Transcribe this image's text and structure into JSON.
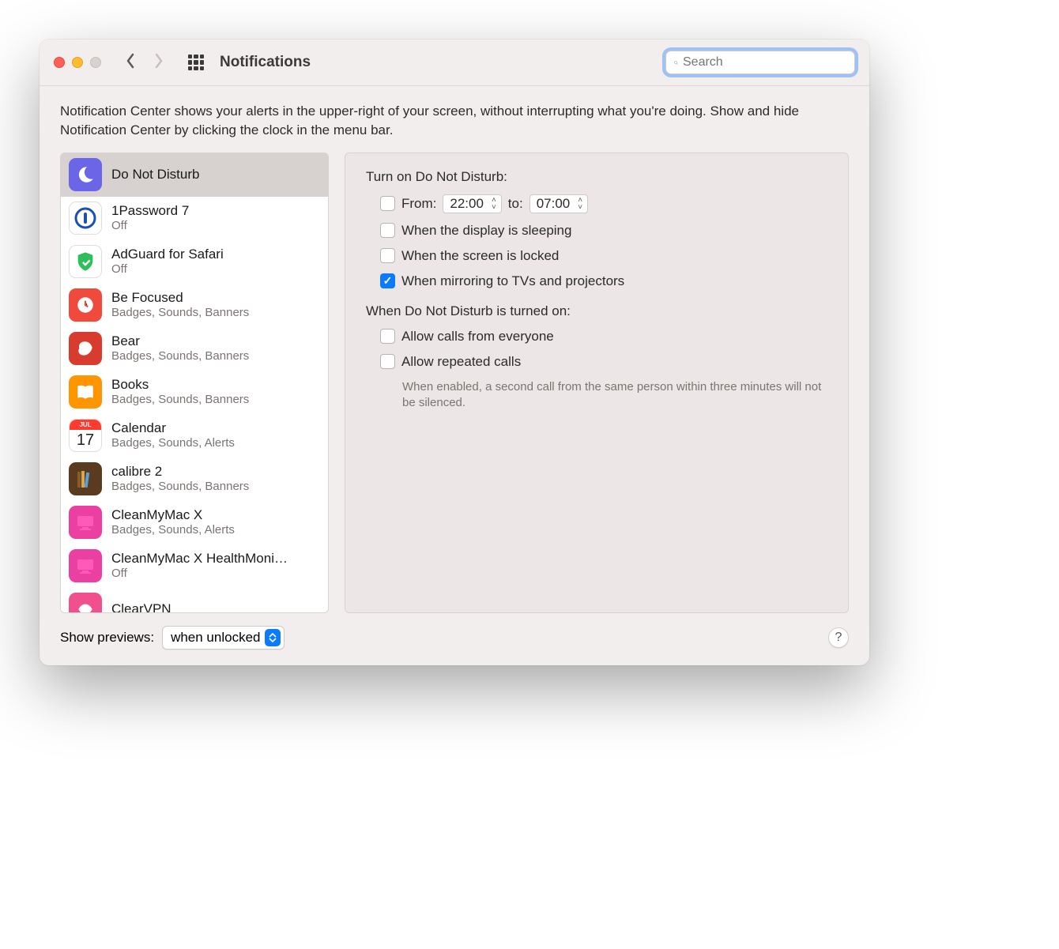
{
  "window": {
    "title": "Notifications",
    "search_placeholder": "Search"
  },
  "description": "Notification Center shows your alerts in the upper-right of your screen, without interrupting what you're doing. Show and hide Notification Center by clicking the clock in the menu bar.",
  "sidebar": {
    "items": [
      {
        "name": "Do Not Disturb",
        "status": "",
        "icon": "moon",
        "icon_bg": "#6b66e8",
        "selected": true
      },
      {
        "name": "1Password 7",
        "status": "Off",
        "icon": "1p",
        "icon_bg": "#fff"
      },
      {
        "name": "AdGuard for Safari",
        "status": "Off",
        "icon": "shield",
        "icon_bg": "#fff"
      },
      {
        "name": "Be Focused",
        "status": "Badges, Sounds, Banners",
        "icon": "clock",
        "icon_bg": "#ef4a3b"
      },
      {
        "name": "Bear",
        "status": "Badges, Sounds, Banners",
        "icon": "bear",
        "icon_bg": "#d83c2f"
      },
      {
        "name": "Books",
        "status": "Badges, Sounds, Banners",
        "icon": "book",
        "icon_bg": "#ff9500"
      },
      {
        "name": "Calendar",
        "status": "Badges, Sounds, Alerts",
        "icon": "cal",
        "icon_bg": "#fff"
      },
      {
        "name": "calibre 2",
        "status": "Badges, Sounds, Banners",
        "icon": "books",
        "icon_bg": "#5b3b1f"
      },
      {
        "name": "CleanMyMac X",
        "status": "Badges, Sounds, Alerts",
        "icon": "cmm",
        "icon_bg": "#ec3fa2"
      },
      {
        "name": "CleanMyMac X HealthMoni…",
        "status": "Off",
        "icon": "cmm",
        "icon_bg": "#ec3fa2"
      },
      {
        "name": "ClearVPN",
        "status": "",
        "icon": "vpn",
        "icon_bg": "#f0508e"
      }
    ]
  },
  "detail": {
    "section1_title": "Turn on Do Not Disturb:",
    "from_label": "From:",
    "from_time": "22:00",
    "to_label": "to:",
    "to_time": "07:00",
    "opt_display_sleeping": "When the display is sleeping",
    "opt_screen_locked": "When the screen is locked",
    "opt_mirroring": "When mirroring to TVs and projectors",
    "section2_title": "When Do Not Disturb is turned on:",
    "opt_allow_everyone": "Allow calls from everyone",
    "opt_allow_repeated": "Allow repeated calls",
    "repeated_help": "When enabled, a second call from the same person within three minutes will not be silenced."
  },
  "footer": {
    "label": "Show previews:",
    "value": "when unlocked"
  },
  "checked": {
    "mirroring": true
  }
}
